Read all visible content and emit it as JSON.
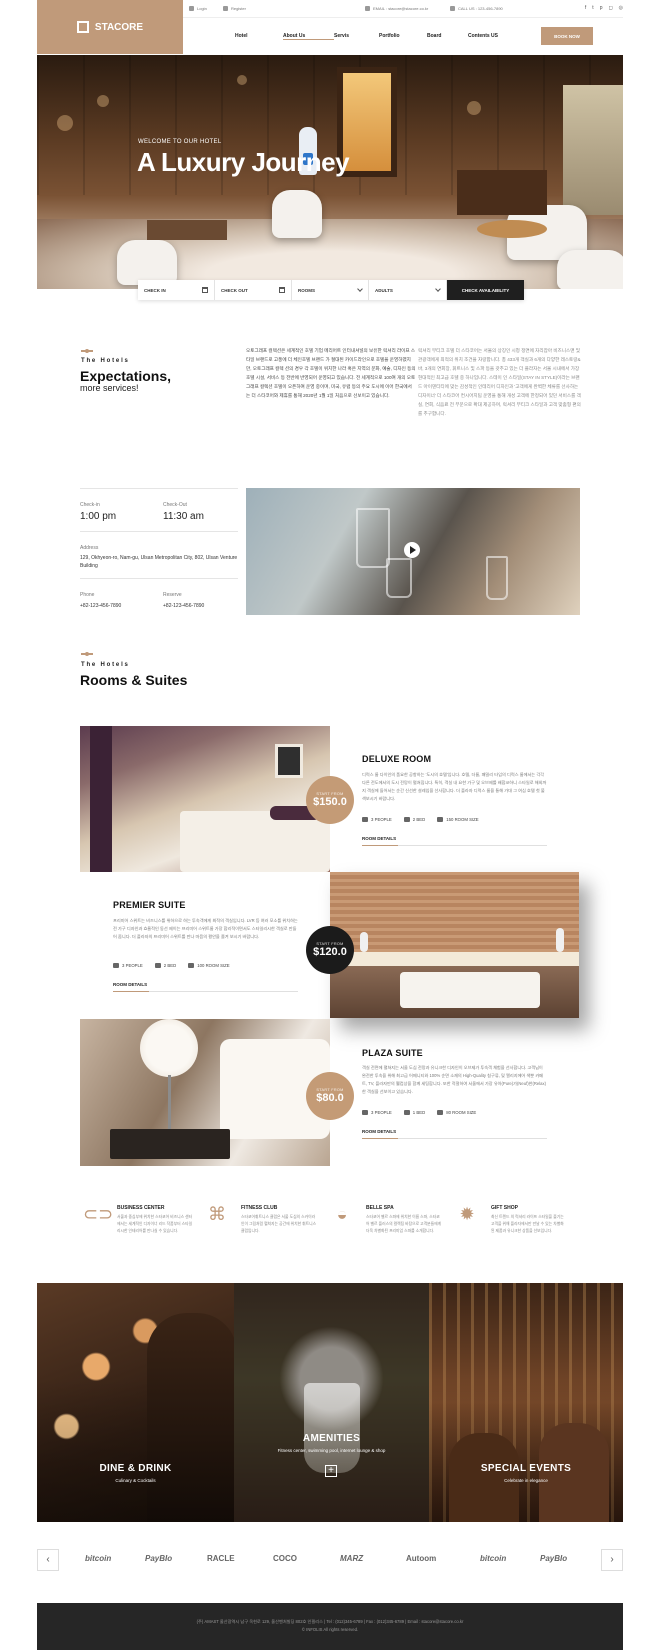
{
  "header": {
    "logo_text": "STACORE",
    "topbar": {
      "login": "Login",
      "register": "Register",
      "email": "EMAIL : stacore@stacore.co.kr",
      "call": "CALL US : 123-456-7890"
    },
    "social_icons": [
      "facebook-icon",
      "twitter-icon",
      "pinterest-icon",
      "instagram-icon",
      "dribbble-icon"
    ],
    "nav": [
      "Hotel",
      "About Us",
      "Servis",
      "Portfolio",
      "Board",
      "Contents US"
    ],
    "active_nav": "About Us",
    "book_now": "BOOK NOW"
  },
  "hero": {
    "subtitle": "WELCOME TO OUR HOTEL",
    "title": "A Luxury Journey"
  },
  "booking": {
    "check_in": "CHECK IN",
    "check_out": "CHECK OUT",
    "rooms": "ROOMS",
    "adults": "ADULTS",
    "button": "CHECK AVAILABILITY"
  },
  "intro": {
    "eyebrow": "The Hotels",
    "heading": "Expectations,",
    "subheading": "more services!",
    "para1": "오토그래프 컬렉션은 세계적인 호텔 기업 메리어트 인터내셔널의 보유한 럭셔리 라이프 스타일 브랜드로 고풍에 더 체인호텔 브랜드 가 절대된 카이드라인으로 호텔을 운영하였지만, 오토그래프 컬렉 션의 경우 각 호텔이 위치한 나라 혹은 지역의 문화, 예술, 디자인 등의 호텔 시설, 서비스 등 전반에 반영되어 운영되고 있습니다. 전 세계적으로 100여 개의 오토그래프 컬렉션 호텔이 오픈하여 운영 중이며, 미국, 유럽 등의 주요 도시에 이어 한국에서는 더 스타코어와 제휴를 통해 2020년 1월 1일 처음으로 선보이고 있습니다.",
    "para2": "럭셔리 부티크 호텔 더 스타코어는 서울의 상징인 시청 정면에 자리잡아 비즈니스맨 및 관광객에게 최적의 위치 조건을 자랑합니다. 총 433개 객실과 6개의 다양한 레스토랑&바, 3개의 연회장, 휘트니스 및 스파 등을 갖추고 있는 더 플라자는 서울 시내에서 가장 현대적인 최고급 호텔 중 하나입니다. 스테이 인 스타일(STAY IN STYLE)이라는 브랜드 아이덴티티에 맞는 감성적인 인테리어 디자인과 '고객에게 완벽한 체류를 선사하는 디자이너' 더 스타코어 컨시어지팀 운영을 통해 개성 고객에 한정되어 있던 서비스를 객실, 연회, 식음료 전 부문으로 확대 제공하며, 럭셔리 부티크 스타일과 고객 맞춤형 편의를 추구합니다."
  },
  "info": {
    "checkin_label": "Check-in",
    "checkin_value": "1:00 pm",
    "checkout_label": "Check-Out",
    "checkout_value": "11:30 am",
    "address_label": "Address",
    "address_value": "129, Okhyeon-ro, Nam-gu, Ulsan Metropolitan City, 802, Ulsan Venture Building",
    "phone_label": "Phone",
    "phone_value": "+82-123-456-7890",
    "reserve_label": "Reserve",
    "reserve_value": "+82-123-456-7890"
  },
  "rooms_section": {
    "eyebrow": "The Hotels",
    "heading": "Rooms & Suites"
  },
  "rooms": [
    {
      "title": "DELUXE ROOM",
      "price_from": "START FROM",
      "price": "$150.0",
      "text": "디럭스 룸 다이인의 품요한 공항하는 '도시의 호텔'입니다. 호텔, 더룸, 패밀리 타입의 디럭스 룸에서는 각각 다른 전도에서의 도시 전망이 펼쳐집니다. 특히, 객실 내 요한 가구 및 오브제를 배합코하니 스타일로 해외까지 객실에 들어서는 순간 신선한 설레임을 선사합니다. 더 플라자 디럭스 룸을 통해 가대 그 여심 호텔 첫 불색보시기 바랍니다.",
      "people": "3 PEOPLE",
      "bed": "2 BED",
      "size": "150 ROOM SIZE",
      "link": "ROOM DETAILS"
    },
    {
      "title": "PREMIER SUITE",
      "price_from": "START FROM",
      "price": "$120.0",
      "text": "프리미어 스위트는 비즈니스를 위하으로 하는 투숙객에게 최적의 객실입니다. LVR 등 여러 모소를 위치하는 전 가구 디자인과 효율적인 동선 제이는 프리미어 스위트룸 가장 합리적이면서도 스타일리시한 객실로 만들어 줍니다. 더 플라자의 프리미어 스위트를 만나 마음의 평안을 즐겨 보시기 바랍니다.",
      "people": "3 PEOPLE",
      "bed": "2 BED",
      "size": "100 ROOM SIZE",
      "link": "ROOM DETAILS"
    },
    {
      "title": "PLAZA SUITE",
      "price_from": "START FROM",
      "price": "$80.0",
      "text": "객실 전면에 펼쳐지는 서울 도심 전망과 유니크한 디자인이 오브제가 투숙객 체험을 선사합니다. 고객님이 완전한 투숙을 위해 최고급 어메니티와 100% 순면 소재의 High-Quality 침구류, 및 엘리지에어 색뿐 카페트, TV, 플라자만의 웰컴상을 함께 세팅합니다. 또한 적절하여 서울에서 가장 유아(Pure)가(Neuf)한(Relax)한 객실을 선보이고 있습니다.",
      "people": "3 PEOPLE",
      "bed": "1 BED",
      "size": "80 ROOM SIZE",
      "link": "ROOM DETAILS"
    }
  ],
  "amenities_row": [
    {
      "icon": "capsule-icon",
      "title": "BUSINESS CENTER",
      "desc": "서울과 중심부에 위치한 스타코어 비즈니스 센터에서는 세계적인 디자이너 리드 작품부터 스타일리시한 인테리어를 만나실 수 있습니다."
    },
    {
      "icon": "command-icon",
      "title": "FITNESS CLUB",
      "desc": "스타코어휘트니스 클럽은 서울 도심의 스카이라인이 그림처럼 펼쳐지는 공간에 위치한 휘트니스 클럽입니다."
    },
    {
      "icon": "drop-icon",
      "title": "BELLE SPA",
      "desc": "스타코어 벨르 스파에 위치한 이름 스파, 스타코어 벨르 플러스의 컬렉팅 바탕으로 고객분들에게 더욱 차별화된 프리미엄 스파를 소개합니다."
    },
    {
      "icon": "sun-icon",
      "title": "GIFT SHOP",
      "desc": "최신 트렌드 의 럭셔리 라이프 스타일을 즐기는 고객을 위해 플라자에서만 만날 수 있는 차별화된 제품과 유니크한 상품을 선보입니다."
    }
  ],
  "banner": {
    "panel1_title": "DINE & DRINK",
    "panel1_sub": "Culinary & Cocktails",
    "panel2_title": "AMENITIES",
    "panel2_sub": "Fitness center, swimming pool, internet lounge & shop",
    "panel3_title": "SPECIAL EVENTS",
    "panel3_sub": "Celebrate in elegance"
  },
  "partners": [
    "bitcoin",
    "PayBIo",
    "RACLE",
    "COCO",
    "MARZ",
    "Autoom",
    "bitcoin",
    "PayBIo"
  ],
  "footer": {
    "line1": "(주) AMAST 울산광역시 남구 옥현로 129, 울산벤처빌딩 802호 인필리스   |   Tel : (012)345-6789   |   Fax : (012)345-6789   |   Email : stacore@stacore.co.kr",
    "line2": "© INFOLIS All rights reserved."
  }
}
